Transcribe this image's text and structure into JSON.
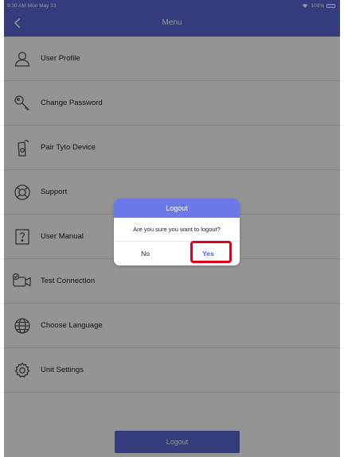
{
  "status_bar": {
    "time_date": "9:30 AM  Mon May 13",
    "battery_text": "100%"
  },
  "nav": {
    "title": "Menu",
    "back_icon": "chevron-left-icon"
  },
  "menu": {
    "items": [
      {
        "label": "User Profile",
        "icon": "user-icon"
      },
      {
        "label": "Change Password",
        "icon": "key-icon"
      },
      {
        "label": "Pair Tyto Device",
        "icon": "device-icon"
      },
      {
        "label": "Support",
        "icon": "lifebuoy-icon"
      },
      {
        "label": "User Manual",
        "icon": "help-manual-icon"
      },
      {
        "label": "Test Connection",
        "icon": "video-camera-icon"
      },
      {
        "label": "Choose Language",
        "icon": "globe-icon"
      },
      {
        "label": "Unit Settings",
        "icon": "gear-icon"
      }
    ]
  },
  "logout_button": {
    "label": "Logout"
  },
  "dialog": {
    "title": "Logout",
    "message": "Are you sure you want to logout?",
    "no_label": "No",
    "yes_label": "Yes"
  },
  "colors": {
    "accent": "#5a68d8",
    "highlight": "#e0001b"
  }
}
